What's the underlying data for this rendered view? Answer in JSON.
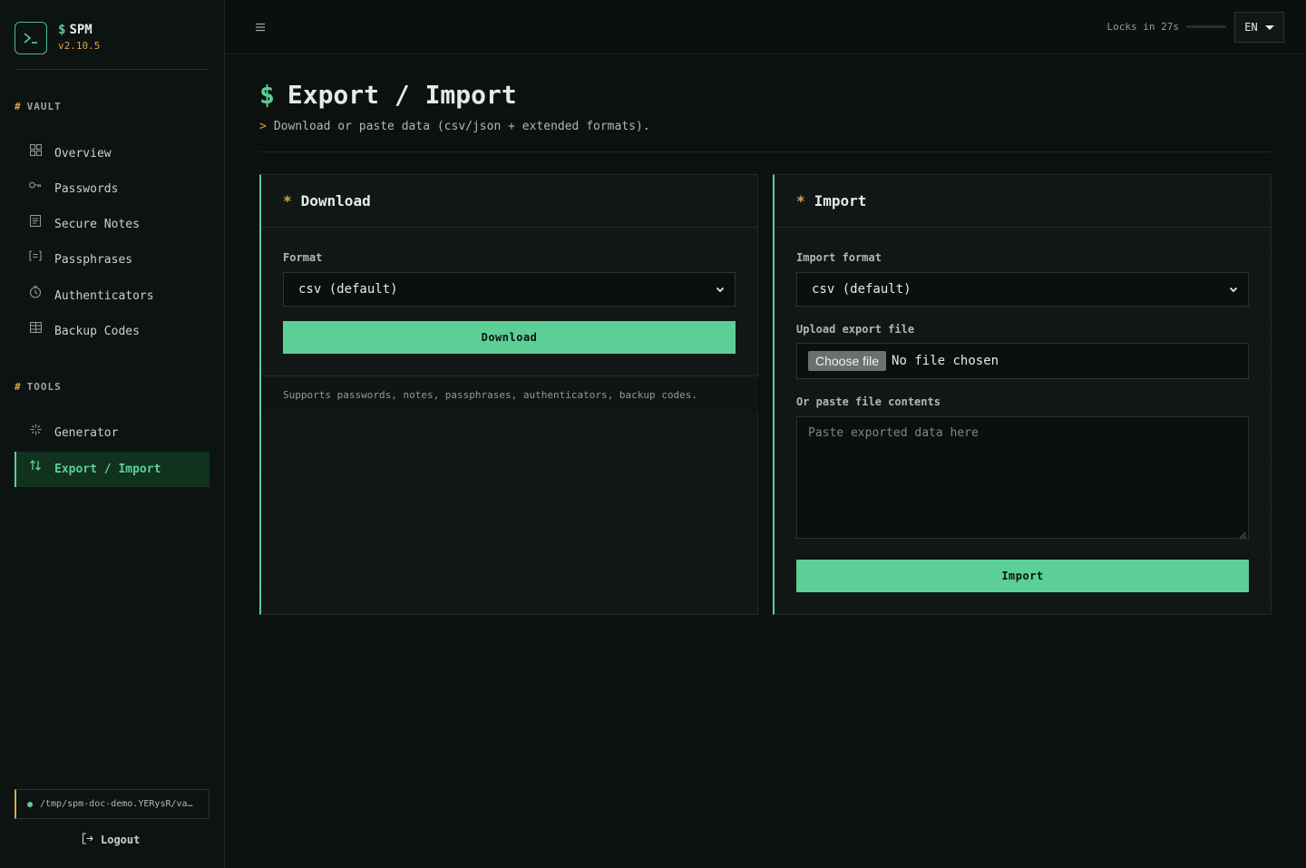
{
  "app": {
    "name": "SPM",
    "prompt_symbol": "$",
    "version": "v2.10.5"
  },
  "sidebar": {
    "vault_title": "VAULT",
    "tools_title": "TOOLS",
    "section_hash": "#",
    "vault_items": [
      {
        "label": "Overview",
        "icon": "grid-icon"
      },
      {
        "label": "Passwords",
        "icon": "key-icon"
      },
      {
        "label": "Secure Notes",
        "icon": "note-icon"
      },
      {
        "label": "Passphrases",
        "icon": "bracket-icon"
      },
      {
        "label": "Authenticators",
        "icon": "clock-icon"
      },
      {
        "label": "Backup Codes",
        "icon": "table-icon"
      }
    ],
    "tool_items": [
      {
        "label": "Generator",
        "icon": "sparkle-icon"
      },
      {
        "label": "Export / Import",
        "icon": "arrows-updown-icon",
        "active": true
      }
    ],
    "vault_path": "/tmp/spm-doc-demo.YERysR/va…",
    "logout_label": "Logout"
  },
  "topbar": {
    "lock_text": "Locks in 27s",
    "language": "EN"
  },
  "page": {
    "title": "Export / Import",
    "subtitle_prefix": ">",
    "subtitle": "Download or paste data (csv/json + extended formats)."
  },
  "download": {
    "title": "Download",
    "format_label": "Format",
    "format_value": "csv (default)",
    "button_label": "Download",
    "footer": "Supports passwords, notes, passphrases, authenticators, backup codes."
  },
  "import": {
    "title": "Import",
    "format_label": "Import format",
    "format_value": "csv (default)",
    "upload_label": "Upload export file",
    "choose_file_label": "Choose file",
    "no_file_text": "No file chosen",
    "paste_label": "Or paste file contents",
    "paste_placeholder": "Paste exported data here",
    "button_label": "Import"
  },
  "colors": {
    "accent": "#5ccf96",
    "warning": "#d9a54c",
    "background": "#0b0f0e"
  }
}
